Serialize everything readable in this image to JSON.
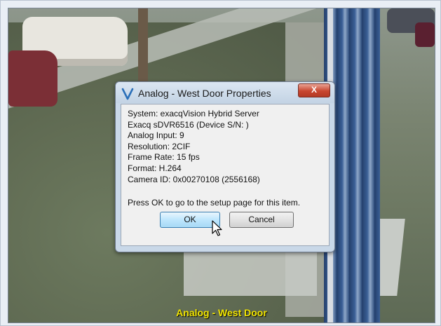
{
  "dialog": {
    "title": "Analog - West Door Properties",
    "close_label": "X",
    "info_lines": [
      "System: exacqVision Hybrid Server",
      "Exacq sDVR6516 (Device S/N: )",
      "Analog Input: 9",
      "Resolution: 2CIF",
      "Frame Rate: 15 fps",
      "Format: H.264",
      "Camera ID: 0x00270108 (2556168)"
    ],
    "prompt": "Press OK to go to the setup page for this item.",
    "ok_label": "OK",
    "cancel_label": "Cancel"
  },
  "video": {
    "camera_caption": "Analog - West Door"
  },
  "colors": {
    "caption": "#f2e500",
    "title_accent": "#2a6fb8",
    "close_button": "#c8462f"
  },
  "icons": {
    "app": "exacq-v-logo-icon",
    "pointer": "mouse-cursor-icon"
  }
}
